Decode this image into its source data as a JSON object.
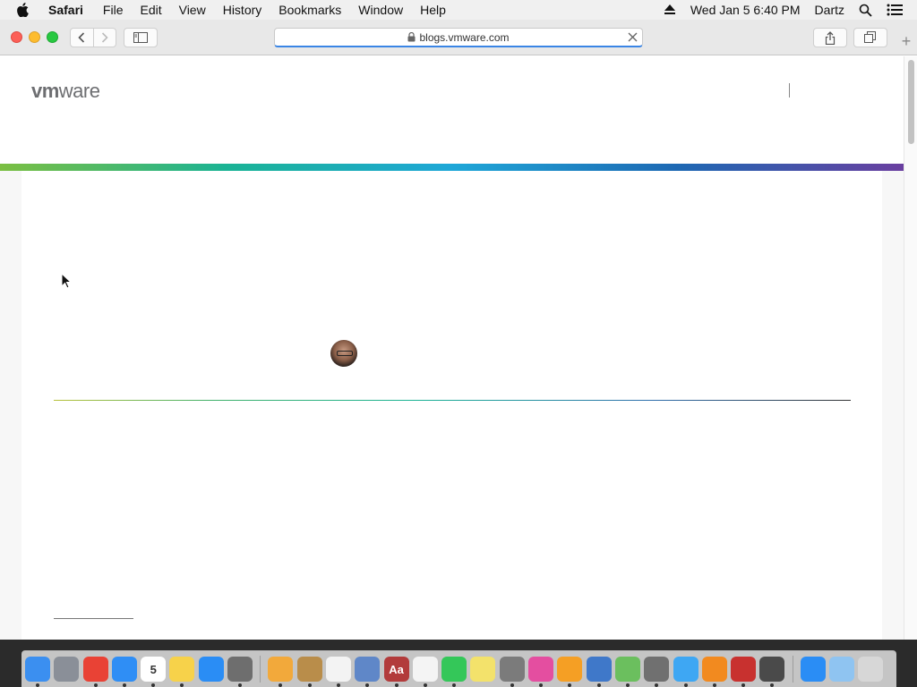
{
  "menubar": {
    "app_name": "Safari",
    "items": [
      "File",
      "Edit",
      "View",
      "History",
      "Bookmarks",
      "Window",
      "Help"
    ],
    "clock": "Wed Jan 5  6:40 PM",
    "user": "Dartz"
  },
  "browser": {
    "url": "blogs.vmware.com"
  },
  "page": {
    "logo_vm": "vm",
    "logo_ware": "ware"
  },
  "dock": {
    "apps": [
      {
        "name": "finder-icon",
        "color": "#3b8ff0"
      },
      {
        "name": "launchpad-icon",
        "color": "#8a8f98"
      },
      {
        "name": "chrome-icon",
        "color": "#e94235"
      },
      {
        "name": "safari-icon",
        "color": "#2f8ef5"
      },
      {
        "name": "calendar-icon",
        "color": "#ffffff",
        "label": "5"
      },
      {
        "name": "notes-icon",
        "color": "#f7d24a"
      },
      {
        "name": "app-store-icon",
        "color": "#2a8df5"
      },
      {
        "name": "system-preferences-icon",
        "color": "#6e6e6e"
      },
      {
        "name": "photos-icon",
        "color": "#f2a93b"
      },
      {
        "name": "notefile-icon",
        "color": "#b98d4a"
      },
      {
        "name": "textedit-icon",
        "color": "#f3f3f3"
      },
      {
        "name": "preview-icon",
        "color": "#5f87c8"
      },
      {
        "name": "dictionary-icon",
        "color": "#b23b3b",
        "label": "Aa"
      },
      {
        "name": "reminders-icon",
        "color": "#f4f4f4"
      },
      {
        "name": "facetime-icon",
        "color": "#34c759"
      },
      {
        "name": "stickies-icon",
        "color": "#f3e26b"
      },
      {
        "name": "disk-utility-icon",
        "color": "#7b7b7b"
      },
      {
        "name": "itunes-icon",
        "color": "#e44ea0"
      },
      {
        "name": "home-icon",
        "color": "#f59f24"
      },
      {
        "name": "xcode-icon",
        "color": "#3f78c9"
      },
      {
        "name": "maps-icon",
        "color": "#6bbf5e"
      },
      {
        "name": "utilities-icon",
        "color": "#707070"
      },
      {
        "name": "messages-icon",
        "color": "#3ea7f3"
      },
      {
        "name": "books-icon",
        "color": "#f28a1f"
      },
      {
        "name": "photo-booth-icon",
        "color": "#c8312f"
      },
      {
        "name": "archive-icon",
        "color": "#4a4a4a"
      },
      {
        "name": "app-store-download-icon",
        "color": "#2a8df5"
      },
      {
        "name": "downloads-folder-icon",
        "color": "#8fc4f1"
      },
      {
        "name": "trash-icon",
        "color": "#d7d7d7"
      }
    ]
  }
}
